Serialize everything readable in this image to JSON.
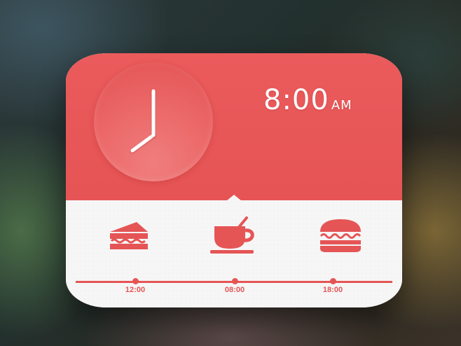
{
  "clock": {
    "hour": 8,
    "minute": 0
  },
  "time": {
    "display": "8:00",
    "ampm": "AM"
  },
  "meals": [
    {
      "icon": "sandwich-icon",
      "time": "12:00"
    },
    {
      "icon": "coffee-cup-icon",
      "time": "08:00"
    },
    {
      "icon": "burger-icon",
      "time": "18:00"
    }
  ],
  "colors": {
    "accent": "#e65455",
    "panel": "#f6f6f6"
  }
}
